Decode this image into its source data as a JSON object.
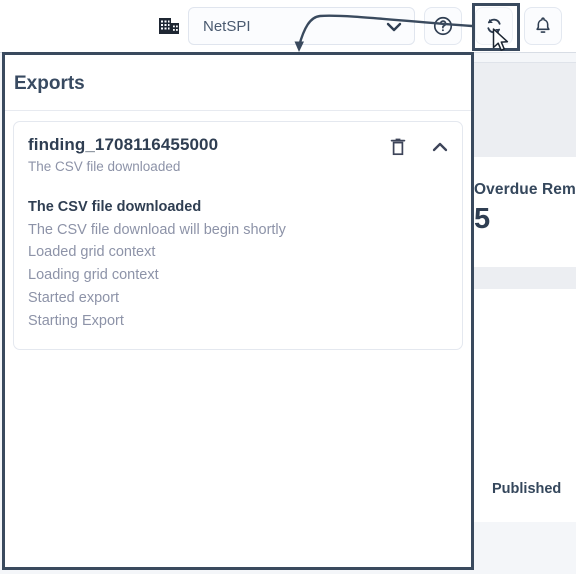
{
  "topbar": {
    "building_icon": "building-icon",
    "org_selector": {
      "value": "NetSPI",
      "chevron_icon": "chevron-down-icon"
    },
    "buttons": [
      {
        "name": "help-button",
        "icon": "question-circle-icon",
        "label": ""
      },
      {
        "name": "sync-button",
        "icon": "refresh-sync-icon",
        "label": ""
      },
      {
        "name": "notifications-button",
        "icon": "bell-icon",
        "label": ""
      }
    ]
  },
  "annotation": {
    "type": "curved-arrow",
    "from": "sync-button",
    "to": "exports-panel",
    "color": "#3a4a5e"
  },
  "exports_panel": {
    "title": "Exports",
    "highlight_color": "#3a4a5e",
    "item": {
      "name": "finding_1708116455000",
      "status": "The CSV file downloaded",
      "delete_icon": "trash-icon",
      "collapse_icon": "chevron-up-icon",
      "log": [
        {
          "text": "The CSV file downloaded",
          "current": true
        },
        {
          "text": "The CSV file download will begin shortly",
          "current": false
        },
        {
          "text": "Loaded grid context",
          "current": false
        },
        {
          "text": "Loading grid context",
          "current": false
        },
        {
          "text": "Started export",
          "current": false
        },
        {
          "text": "Starting Export",
          "current": false
        }
      ]
    }
  },
  "background": {
    "kpi_label": "Overdue Rem",
    "kpi_value": "5",
    "table_cell_published": "Published",
    "accent_text": ""
  },
  "colors": {
    "panel_border": "#3a4a5e",
    "text_primary": "#2f3e52",
    "text_muted": "#8d93a8",
    "page_bg": "#f4f6f9",
    "accent": "#e8622c"
  }
}
